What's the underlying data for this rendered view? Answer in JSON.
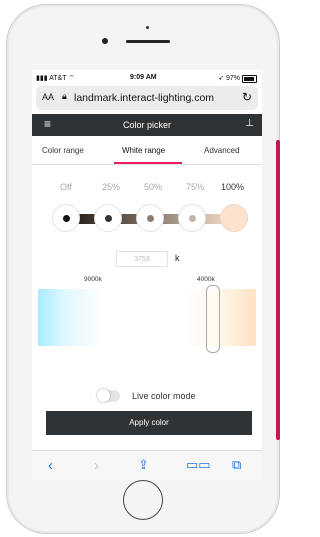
{
  "status_bar": {
    "carrier": "AT&T",
    "time": "9:09 AM",
    "battery": "97%"
  },
  "browser": {
    "text_size_label": "AA",
    "url": "landmark.interact-lighting.com"
  },
  "app_bar": {
    "title": "Color picker",
    "menu_icon": "hamburger-icon",
    "right_icon": "hierarchy-icon"
  },
  "tabs": [
    {
      "label": "Color range",
      "active": false
    },
    {
      "label": "White range",
      "active": true
    },
    {
      "label": "Advanced",
      "active": false
    }
  ],
  "presets": {
    "labels": [
      "Off",
      "25%",
      "50%",
      "75%",
      "100%"
    ],
    "selected": "100%"
  },
  "kelvin": {
    "value_placeholder": "3753",
    "unit": "k"
  },
  "range": {
    "left_label": "9000k",
    "right_label": "4000k"
  },
  "live_mode": {
    "label": "Live color mode",
    "enabled": false
  },
  "apply_button": "Apply color",
  "colors": {
    "accent": "#e91e63",
    "dark_bar": "#2f3336",
    "ios_blue": "#1a73e8"
  }
}
